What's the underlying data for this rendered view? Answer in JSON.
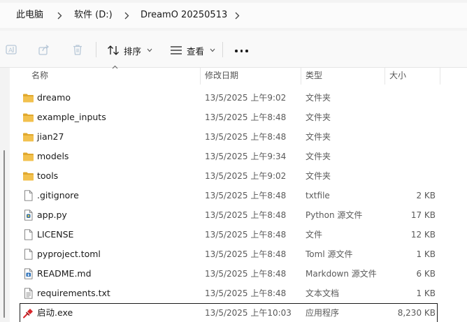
{
  "breadcrumb": {
    "items": [
      "此电脑",
      "软件 (D:)",
      "DreamO 20250513"
    ]
  },
  "toolbar": {
    "sort_label": "排序",
    "view_label": "查看"
  },
  "columns": {
    "name": "名称",
    "date": "修改日期",
    "type": "类型",
    "size": "大小"
  },
  "files": [
    {
      "name": "dreamo",
      "date": "13/5/2025 上午9:02",
      "type": "文件夹",
      "size": "",
      "icon": "folder-icon"
    },
    {
      "name": "example_inputs",
      "date": "13/5/2025 上午8:48",
      "type": "文件夹",
      "size": "",
      "icon": "folder-icon"
    },
    {
      "name": "jian27",
      "date": "13/5/2025 上午8:48",
      "type": "文件夹",
      "size": "",
      "icon": "folder-icon"
    },
    {
      "name": "models",
      "date": "13/5/2025 上午9:34",
      "type": "文件夹",
      "size": "",
      "icon": "folder-icon"
    },
    {
      "name": "tools",
      "date": "13/5/2025 上午9:02",
      "type": "文件夹",
      "size": "",
      "icon": "folder-icon"
    },
    {
      "name": ".gitignore",
      "date": "13/5/2025 上午8:48",
      "type": "txtfile",
      "size": "2 KB",
      "icon": "file-icon"
    },
    {
      "name": "app.py",
      "date": "13/5/2025 上午8:48",
      "type": "Python 源文件",
      "size": "17 KB",
      "icon": "python-file-icon"
    },
    {
      "name": "LICENSE",
      "date": "13/5/2025 上午8:48",
      "type": "文件",
      "size": "12 KB",
      "icon": "file-icon"
    },
    {
      "name": "pyproject.toml",
      "date": "13/5/2025 上午8:48",
      "type": "Toml 源文件",
      "size": "1 KB",
      "icon": "file-icon"
    },
    {
      "name": "README.md",
      "date": "13/5/2025 上午8:48",
      "type": "Markdown 源文件",
      "size": "6 KB",
      "icon": "markdown-file-icon"
    },
    {
      "name": "requirements.txt",
      "date": "13/5/2025 上午8:48",
      "type": "文本文档",
      "size": "1 KB",
      "icon": "text-file-icon"
    },
    {
      "name": "启动.exe",
      "date": "13/5/2025 上午10:03",
      "type": "应用程序",
      "size": "8,230 KB",
      "icon": "exe-icon",
      "selected": true
    }
  ],
  "colors": {
    "folder": "#f2c14e",
    "folder_dark": "#e0a82e",
    "selection_outline": "#1a1a1a",
    "exe_red": "#d8262b"
  }
}
